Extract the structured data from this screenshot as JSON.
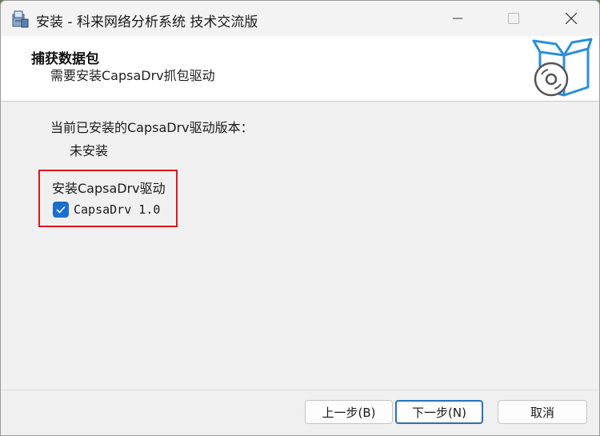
{
  "window": {
    "title": "安装 - 科来网络分析系统 技术交流版"
  },
  "header": {
    "title": "捕获数据包",
    "subtitle": "需要安装CapsaDrv抓包驱动"
  },
  "main": {
    "current_version_label": "当前已安装的CapsaDrv驱动版本：",
    "current_version_value": "未安装",
    "install_label": "安装CapsaDrv驱动",
    "driver_option": {
      "label": "CapsaDrv 1.0",
      "checked": true
    }
  },
  "footer": {
    "back_label": "上一步(B)",
    "next_label": "下一步(N)",
    "cancel_label": "取消"
  },
  "colors": {
    "accent": "#1a6fcf",
    "highlight_border": "#e0141e",
    "logo_blue": "#2a8fd8"
  }
}
